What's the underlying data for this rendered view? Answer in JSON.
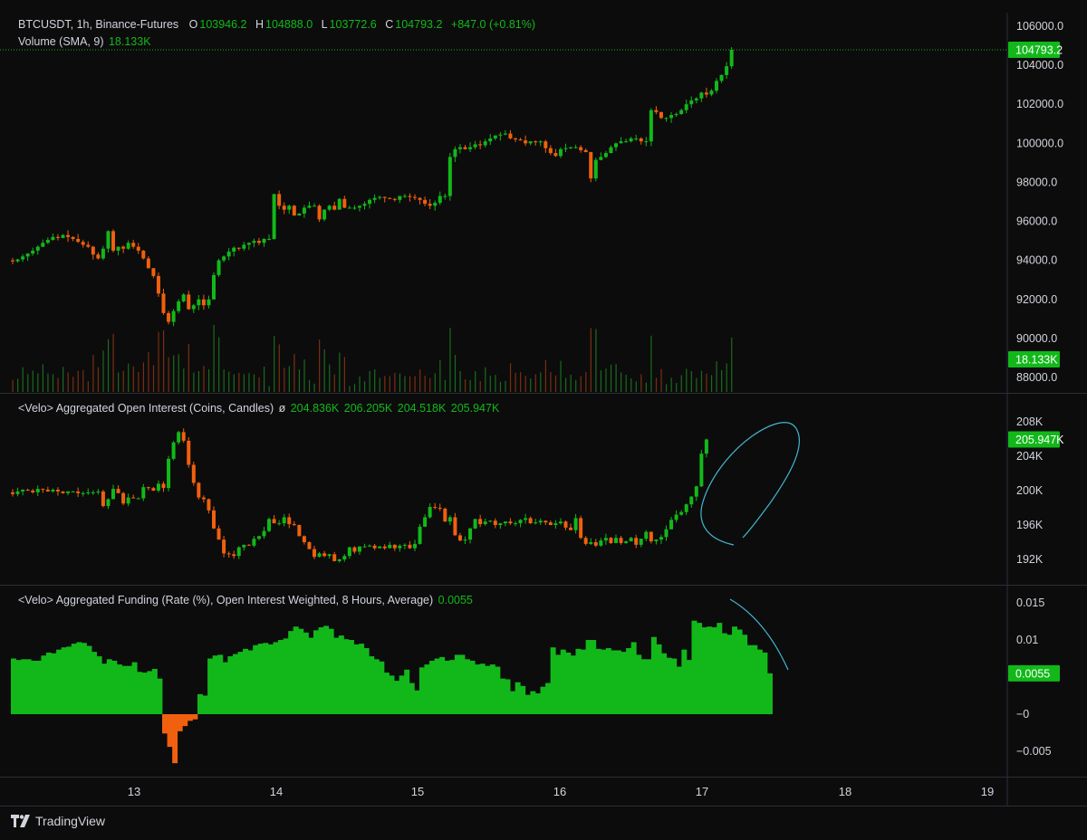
{
  "colors": {
    "background": "#0c0c0c",
    "up": "#12b81a",
    "down": "#f0600e",
    "text": "#d1d4dc",
    "grid_border": "#2a2e39",
    "annotation": "#41b6d1",
    "price_line": "#12b81a",
    "volume_up": "#1a6b1f",
    "volume_down": "#7a2e12"
  },
  "price_legend": {
    "symbol": "BTCUSDT, 1h, Binance-Futures",
    "o_label": "O",
    "o_value": "103946.2",
    "h_label": "H",
    "h_value": "104888.0",
    "l_label": "L",
    "l_value": "103772.6",
    "c_label": "C",
    "c_value": "104793.2",
    "change": "+847.0 (+0.81%)"
  },
  "volume_legend": {
    "label": "Volume (SMA, 9)",
    "value": "18.133K"
  },
  "oi_legend": {
    "label": "<Velo> Aggregated Open Interest (Coins, Candles)",
    "symbol": "ø",
    "values": [
      "204.836K",
      "206.205K",
      "204.518K",
      "205.947K"
    ]
  },
  "funding_legend": {
    "label": "<Velo> Aggregated Funding (Rate (%), Open Interest Weighted, 8 Hours, Average)",
    "value": "0.0055"
  },
  "price_axis": {
    "ticks": [
      "106000.0",
      "104000.0",
      "102000.0",
      "100000.0",
      "98000.0",
      "96000.0",
      "94000.0",
      "92000.0",
      "90000.0",
      "88000.0"
    ],
    "tick_values": [
      106000,
      104000,
      102000,
      100000,
      98000,
      96000,
      94000,
      92000,
      90000,
      88000
    ],
    "last_price_badge": "104793.2",
    "last_price": 104793.2,
    "volume_badge": "18.133K"
  },
  "oi_axis": {
    "ticks": [
      "208K",
      "204K",
      "200K",
      "196K",
      "192K"
    ],
    "tick_values": [
      208,
      204,
      200,
      196,
      192
    ],
    "last_badge": "205.947K",
    "last_value": 205.947
  },
  "funding_axis": {
    "ticks": [
      "0.015",
      "0.01",
      "−0",
      "−0.005"
    ],
    "tick_values": [
      0.015,
      0.01,
      0,
      -0.005
    ],
    "last_badge": "0.0055",
    "last_value": 0.0055
  },
  "time_axis": {
    "labels": [
      "13",
      "14",
      "15",
      "16",
      "17",
      "18",
      "19"
    ]
  },
  "branding": {
    "text": "TradingView"
  },
  "chart_data": [
    {
      "type": "candlestick",
      "name": "BTCUSDT price",
      "ylim": [
        87500,
        106800
      ],
      "start_open": 94000,
      "closes": [
        93950,
        94050,
        94200,
        94350,
        94500,
        94700,
        94900,
        95050,
        95200,
        95150,
        95300,
        95200,
        95100,
        94950,
        94800,
        94700,
        94300,
        94100,
        94600,
        95500,
        94500,
        94700,
        94600,
        94900,
        94700,
        94500,
        94100,
        93600,
        93200,
        92300,
        91300,
        90850,
        91400,
        91900,
        92250,
        91500,
        91700,
        92000,
        91700,
        92000,
        93250,
        94000,
        94200,
        94450,
        94650,
        94600,
        94800,
        94900,
        95000,
        94900,
        95100,
        95100,
        97400,
        96800,
        96600,
        96800,
        96300,
        96400,
        96700,
        96800,
        96800,
        96100,
        96600,
        96800,
        96600,
        97150,
        96700,
        96700,
        96700,
        96800,
        96900,
        97100,
        97200,
        97250,
        97200,
        97150,
        97100,
        97300,
        97300,
        97250,
        97200,
        97100,
        96900,
        96800,
        96950,
        97300,
        97300,
        99300,
        99700,
        99800,
        99700,
        99800,
        99950,
        99900,
        100100,
        100250,
        100400,
        100450,
        100500,
        100250,
        100200,
        100150,
        100000,
        100100,
        100050,
        100100,
        99750,
        99500,
        99350,
        99700,
        99750,
        99800,
        99800,
        99650,
        99550,
        98200,
        99150,
        99300,
        99500,
        99800,
        100000,
        100100,
        100100,
        100250,
        100250,
        100100,
        100100,
        101700,
        101600,
        101300,
        101300,
        101450,
        101500,
        101700,
        102000,
        102200,
        102300,
        102600,
        102500,
        102700,
        103200,
        103500,
        103950,
        104793
      ]
    },
    {
      "type": "bar",
      "name": "Volume",
      "ylim": [
        0,
        68000
      ]
    },
    {
      "type": "candlestick",
      "name": "Aggregated Open Interest",
      "ylim": [
        190500,
        211500
      ],
      "start_open": 199800,
      "closes": [
        199600,
        199900,
        200100,
        200000,
        199800,
        200200,
        200100,
        199900,
        200100,
        199900,
        199700,
        199900,
        199900,
        199700,
        199700,
        199800,
        199800,
        199900,
        198200,
        199000,
        200200,
        199700,
        198500,
        199200,
        199100,
        199100,
        200400,
        200300,
        200000,
        200800,
        200300,
        203700,
        205600,
        206800,
        205800,
        203000,
        200900,
        199200,
        199000,
        197700,
        195600,
        194300,
        192700,
        192600,
        192400,
        193400,
        193700,
        193600,
        194400,
        194700,
        195300,
        196700,
        196200,
        196200,
        196900,
        196100,
        196000,
        194700,
        194000,
        193200,
        192300,
        192700,
        192400,
        192600,
        191800,
        192000,
        192400,
        193400,
        192900,
        193500,
        193500,
        193600,
        193300,
        193500,
        193300,
        193700,
        193300,
        193600,
        193700,
        193300,
        193800,
        195800,
        196900,
        198100,
        198000,
        197900,
        196400,
        196900,
        194800,
        194200,
        194300,
        195600,
        196700,
        196100,
        196400,
        196500,
        196000,
        196200,
        196400,
        196200,
        196200,
        196600,
        196800,
        196200,
        196300,
        196500,
        196300,
        196000,
        196200,
        196400,
        195700,
        195400,
        196800,
        194500,
        193800,
        194000,
        193600,
        194200,
        194500,
        193900,
        194500,
        193900,
        194100,
        194500,
        193700,
        194400,
        195200,
        194100,
        194300,
        194600,
        195500,
        196600,
        197200,
        197500,
        198400,
        199300,
        200500,
        204300,
        205947
      ]
    },
    {
      "type": "bar",
      "name": "Aggregated Funding",
      "ylim": [
        -0.0066,
        0.0167
      ],
      "values": [
        0.0075,
        0.0073,
        0.0074,
        0.0074,
        0.0072,
        0.0072,
        0.0079,
        0.0083,
        0.0082,
        0.0087,
        0.009,
        0.0091,
        0.0095,
        0.0097,
        0.0096,
        0.0092,
        0.0084,
        0.0078,
        0.0068,
        0.0074,
        0.0072,
        0.0067,
        0.0065,
        0.0065,
        0.007,
        0.0057,
        0.0056,
        0.0058,
        0.0061,
        0.0048,
        -0.0026,
        -0.0044,
        -0.0066,
        -0.0023,
        -0.0016,
        -0.0009,
        -0.0007,
        0.0027,
        0.0025,
        0.0075,
        0.0079,
        0.008,
        0.007,
        0.0078,
        0.0081,
        0.0084,
        0.0088,
        0.0086,
        0.0093,
        0.0095,
        0.0096,
        0.0094,
        0.0097,
        0.01,
        0.0102,
        0.0112,
        0.0118,
        0.0115,
        0.011,
        0.0103,
        0.0113,
        0.0117,
        0.0119,
        0.0115,
        0.0103,
        0.0106,
        0.0101,
        0.01,
        0.0094,
        0.0095,
        0.0089,
        0.0078,
        0.0074,
        0.0071,
        0.0056,
        0.0052,
        0.0045,
        0.0052,
        0.006,
        0.0042,
        0.0032,
        0.0063,
        0.0067,
        0.0072,
        0.0075,
        0.0077,
        0.0072,
        0.0073,
        0.008,
        0.008,
        0.0074,
        0.0072,
        0.0067,
        0.0068,
        0.0065,
        0.0067,
        0.0064,
        0.0048,
        0.0047,
        0.0031,
        0.0043,
        0.0038,
        0.0026,
        0.0031,
        0.0028,
        0.0037,
        0.0042,
        0.009,
        0.008,
        0.0087,
        0.0083,
        0.0079,
        0.0088,
        0.0087,
        0.01,
        0.01,
        0.0088,
        0.0087,
        0.0089,
        0.0086,
        0.0086,
        0.0084,
        0.0089,
        0.0097,
        0.008,
        0.0074,
        0.0074,
        0.0104,
        0.0094,
        0.0082,
        0.0076,
        0.0075,
        0.0064,
        0.0087,
        0.0073,
        0.0126,
        0.0123,
        0.0117,
        0.0118,
        0.0117,
        0.0123,
        0.0109,
        0.0107,
        0.0118,
        0.0114,
        0.0107,
        0.0093,
        0.0093,
        0.0087,
        0.0083,
        0.0055
      ]
    }
  ]
}
